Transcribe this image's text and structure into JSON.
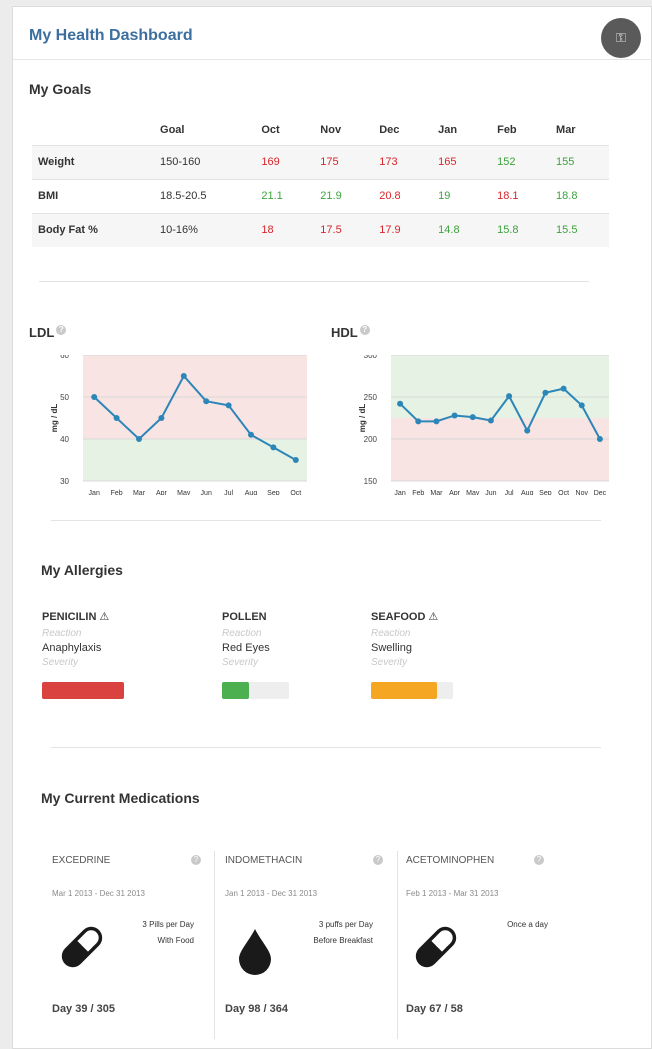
{
  "header": {
    "title": "My Health Dashboard",
    "settings_icon": "key-icon"
  },
  "goals": {
    "title": "My Goals",
    "columns": [
      "",
      "Goal",
      "Oct",
      "Nov",
      "Dec",
      "Jan",
      "Feb",
      "Mar"
    ],
    "rows": [
      {
        "label": "Weight",
        "goal": "150-160",
        "values": [
          {
            "v": "169",
            "status": "red"
          },
          {
            "v": "175",
            "status": "red"
          },
          {
            "v": "173",
            "status": "red"
          },
          {
            "v": "165",
            "status": "red"
          },
          {
            "v": "152",
            "status": "green"
          },
          {
            "v": "155",
            "status": "green"
          }
        ]
      },
      {
        "label": "BMI",
        "goal": "18.5-20.5",
        "values": [
          {
            "v": "21.1",
            "status": "green"
          },
          {
            "v": "21.9",
            "status": "green"
          },
          {
            "v": "20.8",
            "status": "red"
          },
          {
            "v": "19",
            "status": "green"
          },
          {
            "v": "18.1",
            "status": "red"
          },
          {
            "v": "18.8",
            "status": "green"
          }
        ]
      },
      {
        "label": "Body Fat %",
        "goal": "10-16%",
        "values": [
          {
            "v": "18",
            "status": "red"
          },
          {
            "v": "17.5",
            "status": "red"
          },
          {
            "v": "17.9",
            "status": "red"
          },
          {
            "v": "14.8",
            "status": "green"
          },
          {
            "v": "15.8",
            "status": "green"
          },
          {
            "v": "15.5",
            "status": "green"
          }
        ]
      }
    ]
  },
  "chart_data": [
    {
      "type": "line",
      "title": "LDL",
      "ylabel": "mg / dL",
      "categories": [
        "Jan",
        "Feb",
        "Mar",
        "Apr",
        "May",
        "Jun",
        "Jul",
        "Aug",
        "Sep",
        "Oct"
      ],
      "values": [
        50,
        45,
        40,
        45,
        55,
        49,
        48,
        41,
        38,
        35
      ],
      "ylim": [
        30,
        60
      ],
      "yticks": [
        30,
        40,
        50,
        60
      ],
      "bands": [
        {
          "from": 40,
          "to": 60,
          "color": "#f9e4e4"
        },
        {
          "from": 30,
          "to": 40,
          "color": "#e6f3e4"
        }
      ],
      "line_color": "#2d86b8"
    },
    {
      "type": "line",
      "title": "HDL",
      "ylabel": "mg / dL",
      "categories": [
        "Jan",
        "Feb",
        "Mar",
        "Apr",
        "May",
        "Jun",
        "Jul",
        "Aug",
        "Sep",
        "Oct",
        "Nov",
        "Dec"
      ],
      "values": [
        242,
        221,
        221,
        228,
        226,
        222,
        251,
        210,
        255,
        260,
        240,
        200
      ],
      "ylim": [
        150,
        300
      ],
      "yticks": [
        150,
        200,
        250,
        300
      ],
      "bands": [
        {
          "from": 225,
          "to": 300,
          "color": "#e6f3e4"
        },
        {
          "from": 150,
          "to": 225,
          "color": "#f9e4e4"
        }
      ],
      "line_color": "#2d86b8"
    }
  ],
  "allergies": {
    "title": "My Allergies",
    "reaction_label": "Reaction",
    "severity_label": "Severity",
    "items": [
      {
        "name": "PENICILIN",
        "warning": "⚠",
        "reaction": "Anaphylaxis",
        "severity": 1.0,
        "color": "#d9423f"
      },
      {
        "name": "POLLEN",
        "warning": "",
        "reaction": "Red Eyes",
        "severity": 0.4,
        "color": "#4caf50"
      },
      {
        "name": "SEAFOOD",
        "warning": "⚠",
        "reaction": "Swelling",
        "severity": 0.8,
        "color": "#f5a623"
      }
    ]
  },
  "medications": {
    "title": "My Current Medications",
    "info_icon": "info-icon",
    "items": [
      {
        "name": "EXCEDRINE",
        "dates": "Mar 1 2013 - Dec 31 2013",
        "dose1": "3 Pills per Day",
        "dose2": "With Food",
        "icon": "pill-icon",
        "day": "Day 39 / 305"
      },
      {
        "name": "INDOMETHACIN",
        "dates": "Jan 1 2013 - Dec 31 2013",
        "dose1": "3 puffs per Day",
        "dose2": "Before Breakfast",
        "icon": "drop-icon",
        "day": "Day 98 / 364"
      },
      {
        "name": "ACETOMINOPHEN",
        "dates": "Feb 1 2013 - Mar 31 2013",
        "dose1": "Once a day",
        "dose2": "",
        "icon": "pill-icon",
        "day": "Day 67 / 58"
      }
    ]
  }
}
